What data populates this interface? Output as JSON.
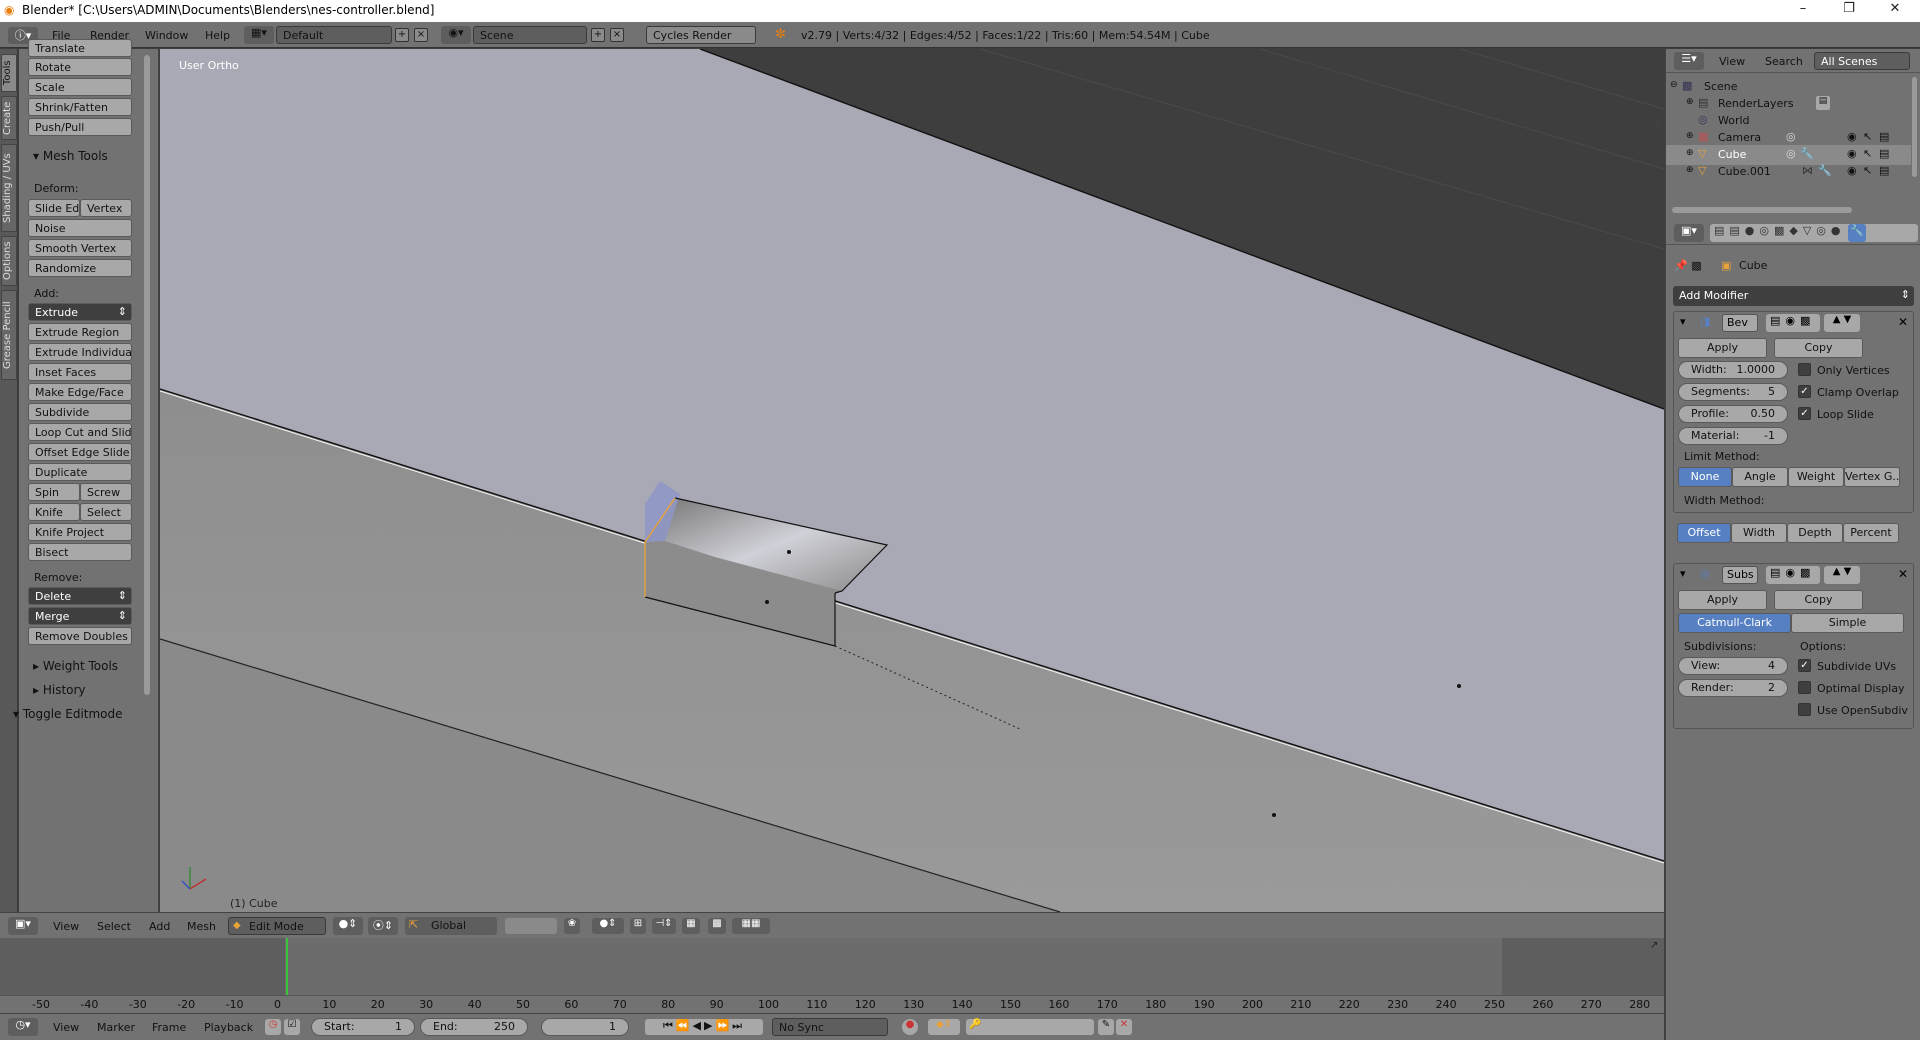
{
  "window": {
    "title": "Blender* [C:\\Users\\ADMIN\\Documents\\Blenders\\nes-controller.blend]",
    "minimize": "–",
    "maximize": "❐",
    "close": "✕"
  },
  "info_header": {
    "menus": [
      "File",
      "Render",
      "Window",
      "Help"
    ],
    "layout": "Default",
    "scene": "Scene",
    "engine": "Cycles Render",
    "stats": "v2.79 | Verts:4/32 | Edges:4/52 | Faces:1/22 | Tris:60 | Mem:54.54M | Cube"
  },
  "tool_tabs": [
    "Tools",
    "Create",
    "Shading / UVs",
    "Options",
    "Grease Pencil"
  ],
  "tool_shelf": {
    "transform_buttons": [
      "Translate",
      "Rotate",
      "Scale",
      "Shrink/Fatten",
      "Push/Pull"
    ],
    "mesh_tools_header": "Mesh Tools",
    "deform_label": "Deform:",
    "slide_edge": "Slide Ed",
    "vertex": "Vertex",
    "deform_buttons": [
      "Noise",
      "Smooth Vertex",
      "Randomize"
    ],
    "add_label": "Add:",
    "extrude": "Extrude",
    "add_buttons": [
      "Extrude Region",
      "Extrude Individual",
      "Inset Faces",
      "Make Edge/Face",
      "Subdivide",
      "Loop Cut and Slide",
      "Offset Edge Slide",
      "Duplicate"
    ],
    "spin": "Spin",
    "screw": "Screw",
    "knife": "Knife",
    "select": "Select",
    "knife_project": "Knife Project",
    "bisect": "Bisect",
    "remove_label": "Remove:",
    "delete": "Delete",
    "merge": "Merge",
    "remove_doubles": "Remove Doubles",
    "weight_tools": "Weight Tools",
    "history": "History",
    "toggle_editmode": "Toggle Editmode"
  },
  "viewport": {
    "view_name": "User Ortho",
    "object_label": "(1) Cube"
  },
  "view3d_header": {
    "menus": [
      "View",
      "Select",
      "Add",
      "Mesh"
    ],
    "mode": "Edit Mode",
    "orientation": "Global"
  },
  "timeline": {
    "ticks": [
      "-50",
      "-40",
      "-30",
      "-20",
      "-10",
      "0",
      "10",
      "20",
      "30",
      "40",
      "50",
      "60",
      "70",
      "80",
      "90",
      "100",
      "110",
      "120",
      "130",
      "140",
      "150",
      "160",
      "170",
      "180",
      "190",
      "200",
      "210",
      "220",
      "230",
      "240",
      "250",
      "260",
      "270",
      "280"
    ],
    "current_frame": 1,
    "menus": [
      "View",
      "Marker",
      "Frame",
      "Playback"
    ],
    "start_label": "Start:",
    "start_value": "1",
    "end_label": "End:",
    "end_value": "250",
    "frame_value": "1",
    "sync": "No Sync"
  },
  "outliner": {
    "menus": [
      "View",
      "Search"
    ],
    "filter": "All Scenes",
    "items": [
      "Scene",
      "RenderLayers",
      "World",
      "Camera",
      "Cube",
      "Cube.001"
    ]
  },
  "properties": {
    "object_name": "Cube",
    "add_modifier": "Add Modifier",
    "bevel": {
      "name": "Bev",
      "apply": "Apply",
      "copy": "Copy",
      "width_label": "Width:",
      "width_value": "1.0000",
      "segments_label": "Segments:",
      "segments_value": "5",
      "profile_label": "Profile:",
      "profile_value": "0.50",
      "material_label": "Material:",
      "material_value": "-1",
      "only_vertices": "Only Vertices",
      "clamp_overlap": "Clamp Overlap",
      "loop_slide": "Loop Slide",
      "limit_method_label": "Limit Method:",
      "limit_methods": [
        "None",
        "Angle",
        "Weight",
        "Vertex G..."
      ],
      "width_method_label": "Width Method:",
      "width_methods": [
        "Offset",
        "Width",
        "Depth",
        "Percent"
      ]
    },
    "subsurf": {
      "name": "Subs",
      "apply": "Apply",
      "copy": "Copy",
      "types": [
        "Catmull-Clark",
        "Simple"
      ],
      "subdivisions_label": "Subdivisions:",
      "view_label": "View:",
      "view_value": "4",
      "render_label": "Render:",
      "render_value": "2",
      "options_label": "Options:",
      "subdivide_uvs": "Subdivide UVs",
      "optimal_display": "Optimal Display",
      "use_opensubdiv": "Use OpenSubdiv"
    }
  },
  "colors": {
    "accent_blue": "#5680c2",
    "vertex_orange": "#e8a23a",
    "frame_green": "#3ac43a"
  }
}
